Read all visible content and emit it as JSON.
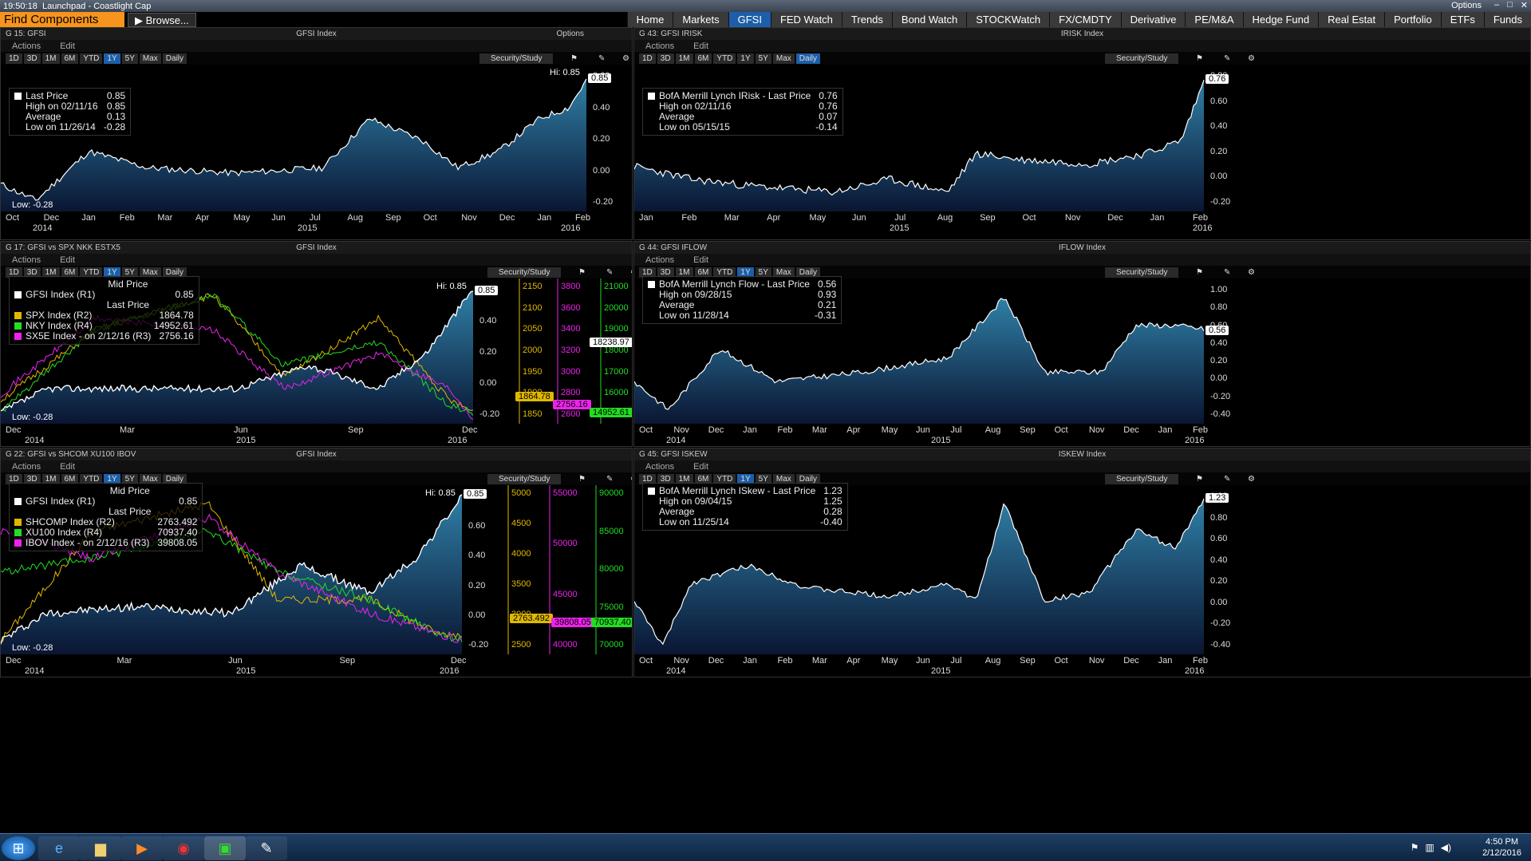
{
  "window": {
    "time": "19:50:18",
    "app": "Launchpad",
    "separator": "-",
    "workspace": "Coastlight Cap",
    "options": "Options"
  },
  "toolbar": {
    "find": "Find Components",
    "browse": "Browse..."
  },
  "nav": [
    "Home",
    "Markets",
    "GFSI",
    "FED Watch",
    "Trends",
    "Bond Watch",
    "STOCKWatch",
    "FX/CMDTY",
    "Derivative",
    "PE/M&A",
    "Hedge Fund",
    "Real Estat",
    "Portfolio",
    "ETFs",
    "Funds"
  ],
  "common": {
    "actions": "Actions",
    "edit": "Edit",
    "security_study": "Security/Study",
    "periods": [
      "1D",
      "3D",
      "1M",
      "6M",
      "YTD",
      "1Y",
      "5Y",
      "Max"
    ],
    "freq": "Daily",
    "options": "Options"
  },
  "panes": {
    "p1": {
      "title": "G 15: GFSI",
      "center": "GFSI Index",
      "hi": "Hi: 0.85",
      "low": "Low: -0.28",
      "last_tag": "0.85",
      "legend": [
        [
          "Last Price",
          "0.85"
        ],
        [
          "High on 02/11/16",
          "0.85"
        ],
        [
          "Average",
          "0.13"
        ],
        [
          "Low on 11/26/14",
          "-0.28"
        ]
      ],
      "yticks": [
        "0.60",
        "0.40",
        "0.20",
        "0.00",
        "-0.20"
      ],
      "months": [
        "Oct",
        "Dec",
        "Jan",
        "Feb",
        "Mar",
        "Apr",
        "May",
        "Jun",
        "Jul",
        "Aug",
        "Sep",
        "Oct",
        "Nov",
        "Dec",
        "Jan",
        "Feb"
      ],
      "years": [
        "2014",
        "2015",
        "2016"
      ]
    },
    "p2": {
      "title": "G 43: GFSI IRISK",
      "center": "IRISK Index",
      "last_tag": "0.76",
      "legend": [
        [
          "BofA Merrill Lynch IRisk - Last Price",
          "0.76"
        ],
        [
          "High on 02/11/16",
          "0.76"
        ],
        [
          "Average",
          "0.07"
        ],
        [
          "Low on 05/15/15",
          "-0.14"
        ]
      ],
      "yticks": [
        "0.80",
        "0.60",
        "0.40",
        "0.20",
        "0.00",
        "-0.20"
      ],
      "months": [
        "Jan",
        "Feb",
        "Mar",
        "Apr",
        "May",
        "Jun",
        "Jul",
        "Aug",
        "Sep",
        "Oct",
        "Nov",
        "Dec",
        "Jan",
        "Feb"
      ],
      "years": [
        "2015",
        "2016"
      ]
    },
    "p3": {
      "title": "G 17: GFSI vs SPX NKK ESTX5",
      "center": "GFSI Index",
      "hi": "Hi: 0.85",
      "low": "Low: -0.28",
      "last_tag": "0.85",
      "legend_head1": "Mid Price",
      "legend_head2": "Last Price",
      "legend": [
        [
          "GFSI Index  (R1)",
          "0.85",
          "#ffffff"
        ],
        [
          "SPX Index  (R2)",
          "1864.78",
          "#e0b800"
        ],
        [
          "NKY Index  (R4)",
          "14952.61",
          "#22dd22"
        ],
        [
          "SX5E Index  -  on 2/12/16  (R3)",
          "2756.16",
          "#ee22ee"
        ]
      ],
      "y1": [
        "0.60",
        "0.40",
        "0.20",
        "0.00",
        "-0.20"
      ],
      "y2": [
        "2150",
        "2100",
        "2050",
        "2000",
        "1950",
        "1900",
        "1850"
      ],
      "y3": [
        "3800",
        "3600",
        "3400",
        "3200",
        "3000",
        "2800",
        "2600"
      ],
      "y4": [
        "21000",
        "20000",
        "19000",
        "18000",
        "17000",
        "16000",
        "15000"
      ],
      "tags": [
        "1864.78",
        "2756.16",
        "14952.61",
        "18238.97"
      ],
      "months": [
        "Dec",
        "Mar",
        "Jun",
        "Sep",
        "Dec"
      ],
      "years": [
        "2014",
        "2015",
        "2016"
      ]
    },
    "p4": {
      "title": "G 44: GFSI IFLOW",
      "center": "IFLOW Index",
      "last_tag": "0.56",
      "legend": [
        [
          "BofA Merrill Lynch Flow - Last Price",
          "0.56"
        ],
        [
          "High on 09/28/15",
          "0.93"
        ],
        [
          "Average",
          "0.21"
        ],
        [
          "Low on 11/28/14",
          "-0.31"
        ]
      ],
      "yticks": [
        "1.00",
        "0.80",
        "0.60",
        "0.40",
        "0.20",
        "0.00",
        "-0.20",
        "-0.40"
      ],
      "months": [
        "Oct",
        "Nov",
        "Dec",
        "Jan",
        "Feb",
        "Mar",
        "Apr",
        "May",
        "Jun",
        "Jul",
        "Aug",
        "Sep",
        "Oct",
        "Nov",
        "Dec",
        "Jan",
        "Feb"
      ],
      "years": [
        "2014",
        "2015",
        "2016"
      ]
    },
    "p5": {
      "title": "G 22: GFSI vs SHCOM XU100 IBOV",
      "center": "GFSI Index",
      "hi": "Hi: 0.85",
      "low": "Low: -0.28",
      "last_tag": "0.85",
      "legend_head1": "Mid Price",
      "legend_head2": "Last Price",
      "legend": [
        [
          "GFSI Index  (R1)",
          "0.85",
          "#ffffff"
        ],
        [
          "SHCOMP Index  (R2)",
          "2763.492",
          "#e0b800"
        ],
        [
          "XU100 Index  (R4)",
          "70937.40",
          "#22dd22"
        ],
        [
          "IBOV Index  -  on 2/12/16  (R3)",
          "39808.05",
          "#ee22ee"
        ]
      ],
      "y1": [
        "0.80",
        "0.60",
        "0.40",
        "0.20",
        "0.00",
        "-0.20"
      ],
      "y2": [
        "5000",
        "4500",
        "4000",
        "3500",
        "3000",
        "2500"
      ],
      "y3": [
        "55000",
        "50000",
        "45000",
        "40000"
      ],
      "y4": [
        "90000",
        "85000",
        "80000",
        "75000",
        "70000"
      ],
      "tags": [
        "2763.492",
        "39808.05",
        "70937.40"
      ],
      "months": [
        "Dec",
        "Mar",
        "Jun",
        "Sep",
        "Dec"
      ],
      "years": [
        "2014",
        "2015",
        "2016"
      ]
    },
    "p6": {
      "title": "G 45: GFSI ISKEW",
      "center": "ISKEW Index",
      "last_tag": "1.23",
      "legend": [
        [
          "BofA Merrill Lynch ISkew - Last Price",
          "1.23"
        ],
        [
          "High on 09/04/15",
          "1.25"
        ],
        [
          "Average",
          "0.28"
        ],
        [
          "Low on 11/25/14",
          "-0.40"
        ]
      ],
      "yticks": [
        "1.00",
        "0.80",
        "0.60",
        "0.40",
        "0.20",
        "0.00",
        "-0.20",
        "-0.40"
      ],
      "months": [
        "Oct",
        "Nov",
        "Dec",
        "Jan",
        "Feb",
        "Mar",
        "Apr",
        "May",
        "Jun",
        "Jul",
        "Aug",
        "Sep",
        "Oct",
        "Nov",
        "Dec",
        "Jan",
        "Feb"
      ],
      "years": [
        "2014",
        "2015",
        "2016"
      ]
    }
  },
  "colors": {
    "area_top": "#2f7fa6",
    "area_bottom": "#0a1633",
    "line": "#ffffff",
    "spx": "#e0b800",
    "nky": "#22dd22",
    "sx5e": "#ee22ee",
    "accent": "#f7941d",
    "nav_active": "#1c5fa8"
  },
  "clock": {
    "time": "4:50 PM",
    "date": "2/12/2016"
  }
}
